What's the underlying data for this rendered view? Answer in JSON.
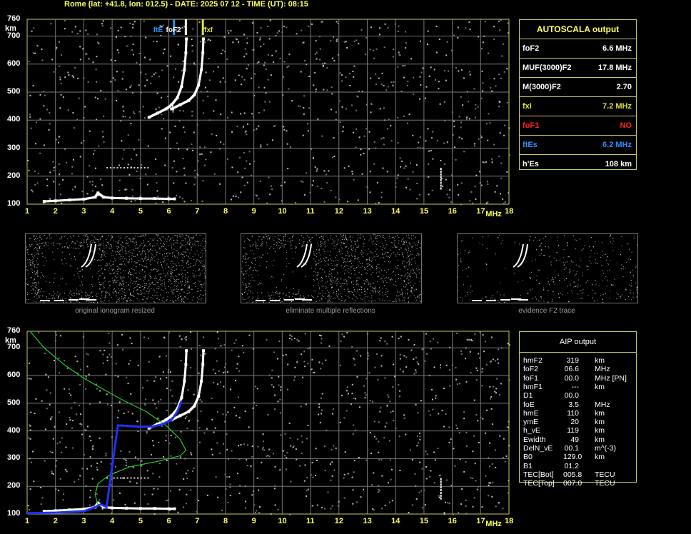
{
  "header": "Rome (lat: +41.8, lon: 012.5) - DATE: 2025 07 12 - TIME (UT): 08:15",
  "axes": {
    "y_unit": "km",
    "x_unit": "MHz",
    "y_ticks": [
      "760",
      "700",
      "600",
      "500",
      "400",
      "300",
      "200",
      "100"
    ],
    "y_tick_values": [
      760,
      700,
      600,
      500,
      400,
      300,
      200,
      100
    ],
    "x_ticks": [
      "1",
      "2",
      "3",
      "4",
      "5",
      "6",
      "7",
      "8",
      "9",
      "10",
      "11",
      "12",
      "13",
      "14",
      "15",
      "16",
      "17",
      "18"
    ],
    "x_tick_values": [
      1,
      2,
      3,
      4,
      5,
      6,
      7,
      8,
      9,
      10,
      11,
      12,
      13,
      14,
      15,
      16,
      17,
      18
    ]
  },
  "markers": {
    "ftEs": "ftE",
    "foF2": "foF2",
    "fxI": "fxI"
  },
  "autoscala": {
    "title": "AUTOSCALA output",
    "rows": [
      {
        "key": "foF2",
        "value": "6.6 MHz",
        "color": "#ffffff"
      },
      {
        "key": "MUF(3000)F2",
        "value": "17.8 MHz",
        "color": "#ffffff"
      },
      {
        "key": "M(3000)F2",
        "value": "2.70",
        "color": "#ffffff"
      },
      {
        "key": "fxI",
        "value": "7.2 MHz",
        "color": "#e0e040"
      },
      {
        "key": "foF1",
        "value": "NO",
        "color": "#ff2020"
      },
      {
        "key": "ftEs",
        "value": "6.2 MHz",
        "color": "#3090ff"
      },
      {
        "key": "h'Es",
        "value": "108    km",
        "color": "#ffffff"
      }
    ]
  },
  "thumbs": {
    "cap1": "original ionogram resized",
    "cap2": "eliminate multiple reflections",
    "cap3": "evidence F2 trace"
  },
  "aip": {
    "title": "AIP output",
    "rows": [
      {
        "k": "hmF2",
        "v": "319",
        "u": "km"
      },
      {
        "k": "foF2",
        "v": "06.6",
        "u": "MHz"
      },
      {
        "k": "foF1",
        "v": "00.0",
        "u": "MHz   [PN]"
      },
      {
        "k": "hmF1",
        "v": "---",
        "u": "km"
      },
      {
        "k": "D1",
        "v": "00.0",
        "u": ""
      },
      {
        "k": "foE",
        "v": "3.5",
        "u": "MHz"
      },
      {
        "k": "hmE",
        "v": "110",
        "u": "km"
      },
      {
        "k": "ymE",
        "v": "20",
        "u": "km"
      },
      {
        "k": "h_vE",
        "v": "119",
        "u": "km"
      },
      {
        "k": "Ewidth",
        "v": "49",
        "u": "km"
      },
      {
        "k": "DelN_vE",
        "v": "00.1",
        "u": "m^(-3)"
      },
      {
        "k": "B0",
        "v": "129.0",
        "u": "km"
      },
      {
        "k": "B1",
        "v": "01.2",
        "u": ""
      },
      {
        "k": "TEC[Bot]",
        "v": "005.8",
        "u": "TECU"
      },
      {
        "k": "TEC[Top]",
        "v": "007.0",
        "u": "TECU"
      }
    ]
  },
  "chart_data": [
    {
      "type": "scatter",
      "title": "",
      "xlabel": "MHz",
      "ylabel": "km",
      "xlim": [
        1,
        18
      ],
      "ylim": [
        100,
        760
      ],
      "series": [
        {
          "values_desc": "E/Es trace",
          "points": [
            [
              1.6,
              110
            ],
            [
              2.0,
              112
            ],
            [
              2.5,
              115
            ],
            [
              3.0,
              118
            ],
            [
              3.4,
              125
            ],
            [
              3.5,
              140
            ],
            [
              3.7,
              125
            ],
            [
              4.0,
              122
            ],
            [
              4.5,
              121
            ],
            [
              5.0,
              120
            ],
            [
              5.5,
              120
            ],
            [
              6.0,
              119
            ],
            [
              6.2,
              119
            ]
          ]
        },
        {
          "values_desc": "F2 ordinary",
          "points": [
            [
              5.3,
              410
            ],
            [
              5.6,
              425
            ],
            [
              5.9,
              440
            ],
            [
              6.1,
              455
            ],
            [
              6.3,
              480
            ],
            [
              6.45,
              520
            ],
            [
              6.55,
              580
            ],
            [
              6.6,
              640
            ],
            [
              6.62,
              690
            ]
          ]
        },
        {
          "values_desc": "F2 extraordinary",
          "points": [
            [
              6.1,
              440
            ],
            [
              6.4,
              455
            ],
            [
              6.7,
              470
            ],
            [
              6.9,
              490
            ],
            [
              7.05,
              525
            ],
            [
              7.15,
              580
            ],
            [
              7.2,
              640
            ],
            [
              7.22,
              690
            ]
          ]
        }
      ]
    },
    {
      "type": "line",
      "title": "",
      "xlabel": "MHz",
      "ylabel": "km",
      "xlim": [
        1,
        18
      ],
      "ylim": [
        100,
        760
      ],
      "series": [
        {
          "values_desc": "electron density profile",
          "points": [
            [
              1.1,
              760
            ],
            [
              1.6,
              700
            ],
            [
              2.3,
              640
            ],
            [
              3.0,
              590
            ],
            [
              3.7,
              550
            ],
            [
              4.4,
              510
            ],
            [
              5.2,
              470
            ],
            [
              5.9,
              420
            ],
            [
              6.4,
              370
            ],
            [
              6.6,
              330
            ],
            [
              6.4,
              310
            ],
            [
              5.6,
              290
            ],
            [
              4.6,
              270
            ],
            [
              3.9,
              240
            ],
            [
              3.5,
              210
            ],
            [
              3.4,
              170
            ],
            [
              3.5,
              130
            ],
            [
              3.2,
              115
            ],
            [
              2.2,
              108
            ],
            [
              1.0,
              104
            ]
          ]
        },
        {
          "values_desc": "virtual height fit",
          "points": [
            [
              1.0,
              103
            ],
            [
              2.0,
              105
            ],
            [
              3.0,
              110
            ],
            [
              3.4,
              125
            ],
            [
              3.6,
              135
            ],
            [
              3.8,
              125
            ],
            [
              4.2,
              420
            ],
            [
              4.6,
              418
            ],
            [
              5.0,
              415
            ],
            [
              5.4,
              415
            ],
            [
              5.8,
              425
            ],
            [
              6.1,
              440
            ],
            [
              6.3,
              470
            ],
            [
              6.45,
              510
            ]
          ]
        }
      ]
    }
  ]
}
